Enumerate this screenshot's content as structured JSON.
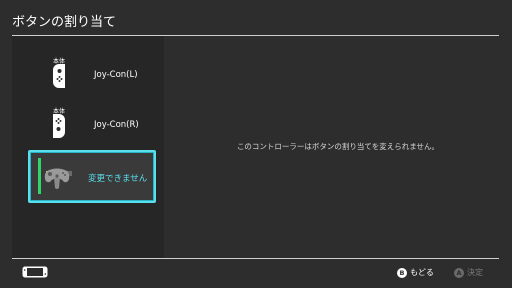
{
  "header": {
    "title": "ボタンの割り当て"
  },
  "controllers": [
    {
      "caption": "本体",
      "name": "Joy-Con(L)",
      "icon": "joycon-left-icon"
    },
    {
      "caption": "本体",
      "name": "Joy-Con(R)",
      "icon": "joycon-right-icon"
    }
  ],
  "selected_controller": {
    "status_text": "変更できません",
    "icon": "n64-controller-icon",
    "player_leds": [
      true,
      false,
      false,
      false
    ]
  },
  "message": "このコントローラーはボタンの割り当てを変えられません。",
  "footer": {
    "back": {
      "key": "B",
      "label": "もどる"
    },
    "ok": {
      "key": "A",
      "label": "決定"
    }
  },
  "colors": {
    "background": "#2d2d2d",
    "sidebar": "#262626",
    "accent": "#59e0ee",
    "led_on": "#ffe82a",
    "status_bar": "#31d66b"
  }
}
